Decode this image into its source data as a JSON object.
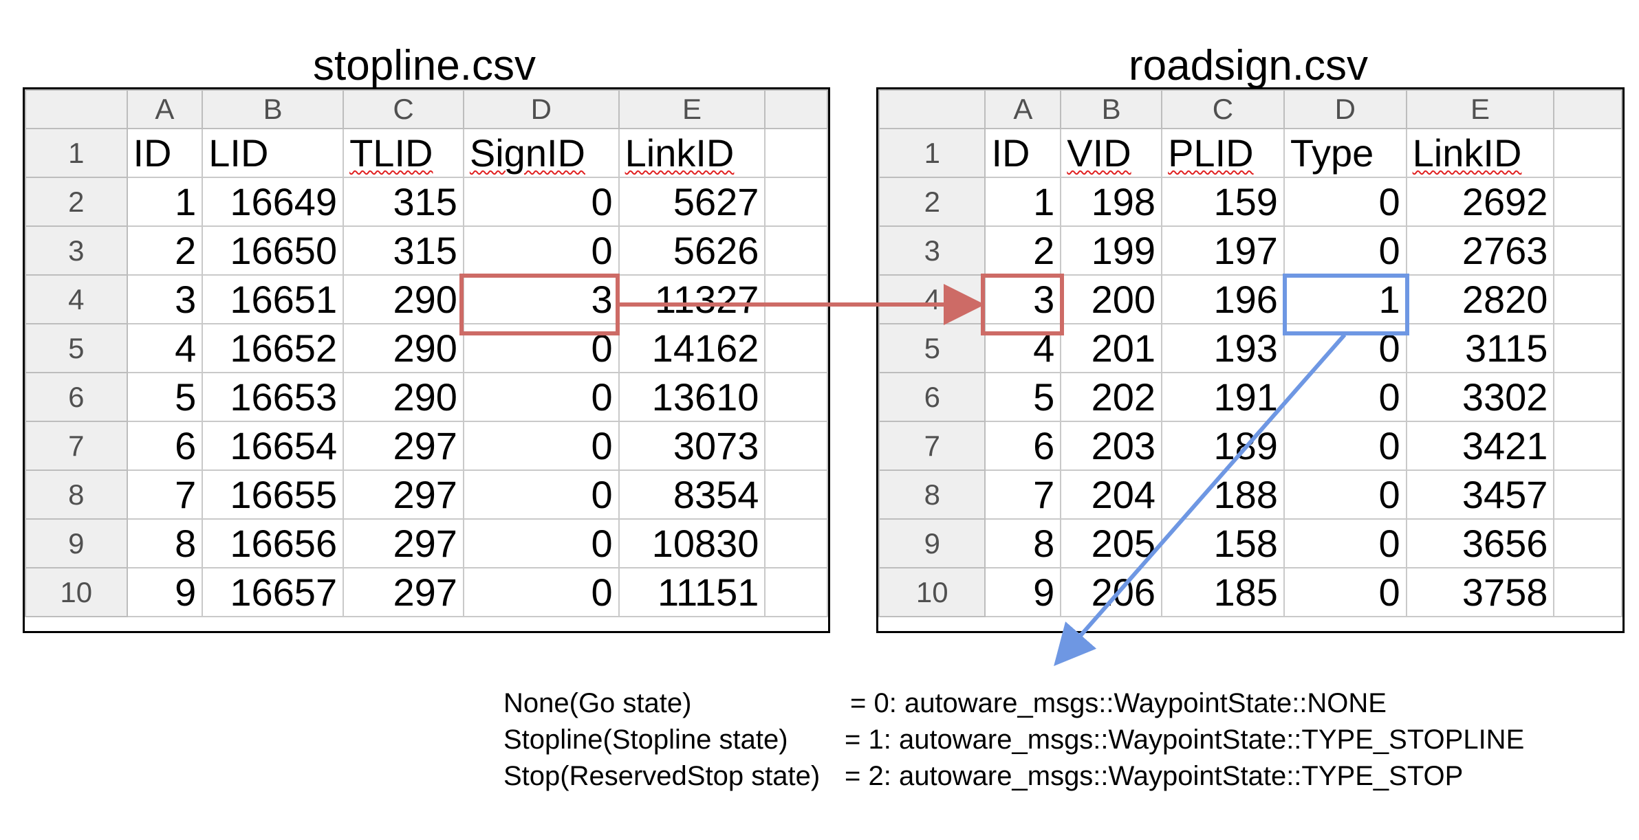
{
  "left": {
    "title": "stopline.csv",
    "col_letters": [
      "A",
      "B",
      "C",
      "D",
      "E"
    ],
    "headers": [
      "ID",
      "LID",
      "TLID",
      "SignID",
      "LinkID"
    ],
    "row_numbers": [
      "1",
      "2",
      "3",
      "4",
      "5",
      "6",
      "7",
      "8",
      "9",
      "10"
    ],
    "rows": [
      [
        "1",
        "16649",
        "315",
        "0",
        "5627"
      ],
      [
        "2",
        "16650",
        "315",
        "0",
        "5626"
      ],
      [
        "3",
        "16651",
        "290",
        "3",
        "11327"
      ],
      [
        "4",
        "16652",
        "290",
        "0",
        "14162"
      ],
      [
        "5",
        "16653",
        "290",
        "0",
        "13610"
      ],
      [
        "6",
        "16654",
        "297",
        "0",
        "3073"
      ],
      [
        "7",
        "16655",
        "297",
        "0",
        "8354"
      ],
      [
        "8",
        "16656",
        "297",
        "0",
        "10830"
      ],
      [
        "9",
        "16657",
        "297",
        "0",
        "11151"
      ]
    ]
  },
  "right": {
    "title": "roadsign.csv",
    "col_letters": [
      "A",
      "B",
      "C",
      "D",
      "E"
    ],
    "headers": [
      "ID",
      "VID",
      "PLID",
      "Type",
      "LinkID"
    ],
    "row_numbers": [
      "1",
      "2",
      "3",
      "4",
      "5",
      "6",
      "7",
      "8",
      "9",
      "10"
    ],
    "rows": [
      [
        "1",
        "198",
        "159",
        "0",
        "2692"
      ],
      [
        "2",
        "199",
        "197",
        "0",
        "2763"
      ],
      [
        "3",
        "200",
        "196",
        "1",
        "2820"
      ],
      [
        "4",
        "201",
        "193",
        "0",
        "3115"
      ],
      [
        "5",
        "202",
        "191",
        "0",
        "3302"
      ],
      [
        "6",
        "203",
        "189",
        "0",
        "3421"
      ],
      [
        "7",
        "204",
        "188",
        "0",
        "3457"
      ],
      [
        "8",
        "205",
        "158",
        "0",
        "3656"
      ],
      [
        "9",
        "206",
        "185",
        "0",
        "3758"
      ]
    ]
  },
  "legend": [
    {
      "name": "None(Go state)",
      "value": "= 0: autoware_msgs::WaypointState::NONE"
    },
    {
      "name": "Stopline(Stopline state)",
      "value": "= 1: autoware_msgs::WaypointState::TYPE_STOPLINE"
    },
    {
      "name": "Stop(ReservedStop state)",
      "value": "= 2: autoware_msgs::WaypointState::TYPE_STOP"
    }
  ],
  "colors": {
    "red_highlight": "#cd6b66",
    "blue_highlight": "#6e97e3",
    "spell_underline": "#e02020",
    "header_bg": "#efefef"
  }
}
